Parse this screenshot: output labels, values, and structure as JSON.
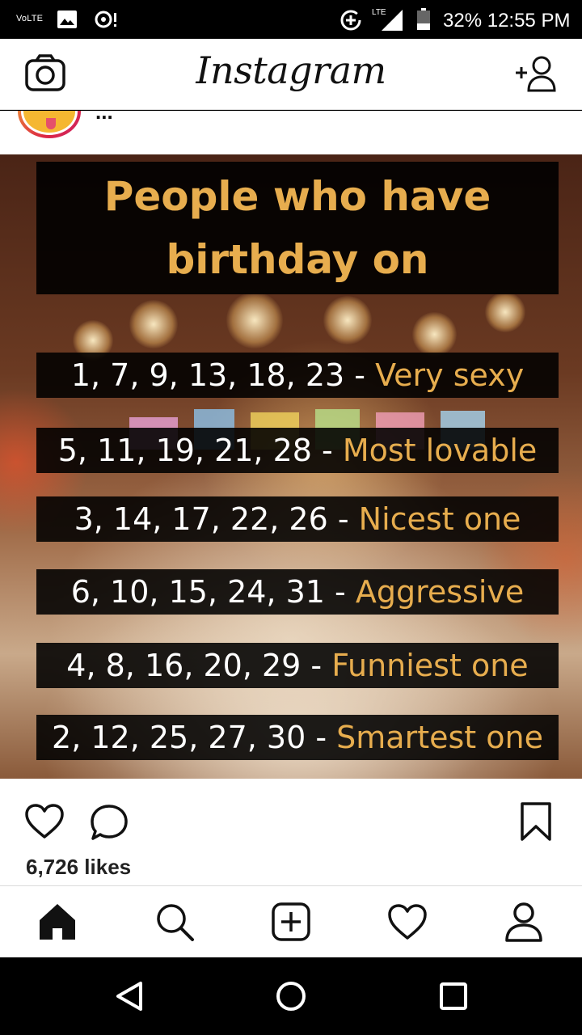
{
  "status_bar": {
    "network_label": "VoLTE",
    "lte_label": "LTE",
    "battery": "32%",
    "time": "12:55 PM"
  },
  "header": {
    "logo": "Instagram",
    "icons": [
      "camera-icon",
      "add-person-icon"
    ]
  },
  "post": {
    "username": "...",
    "image": {
      "title_line1": "People who have",
      "title_line2": "birthday on",
      "rows": [
        {
          "days": "1, 7, 9, 13, 18, 23",
          "sep": " - ",
          "trait": "Very sexy"
        },
        {
          "days": "5, 11, 19, 21, 28",
          "sep": " - ",
          "trait": "Most lovable"
        },
        {
          "days": "3, 14, 17, 22, 26",
          "sep": " - ",
          "trait": "Nicest one"
        },
        {
          "days": "6, 10, 15, 24, 31",
          "sep": " - ",
          "trait": "Aggressive"
        },
        {
          "days": "4, 8, 16, 20, 29",
          "sep": " - ",
          "trait": "Funniest one"
        },
        {
          "days": "2, 12, 25, 27, 30",
          "sep": " - ",
          "trait": "Smartest one"
        }
      ],
      "title_color": "#e7ad4e"
    },
    "likes": "6,726 likes"
  },
  "tabbar": {
    "tabs": [
      "home-icon",
      "search-icon",
      "add-post-icon",
      "activity-heart-icon",
      "profile-icon"
    ]
  },
  "android_nav": [
    "back-icon",
    "home-circle-icon",
    "recents-icon"
  ]
}
